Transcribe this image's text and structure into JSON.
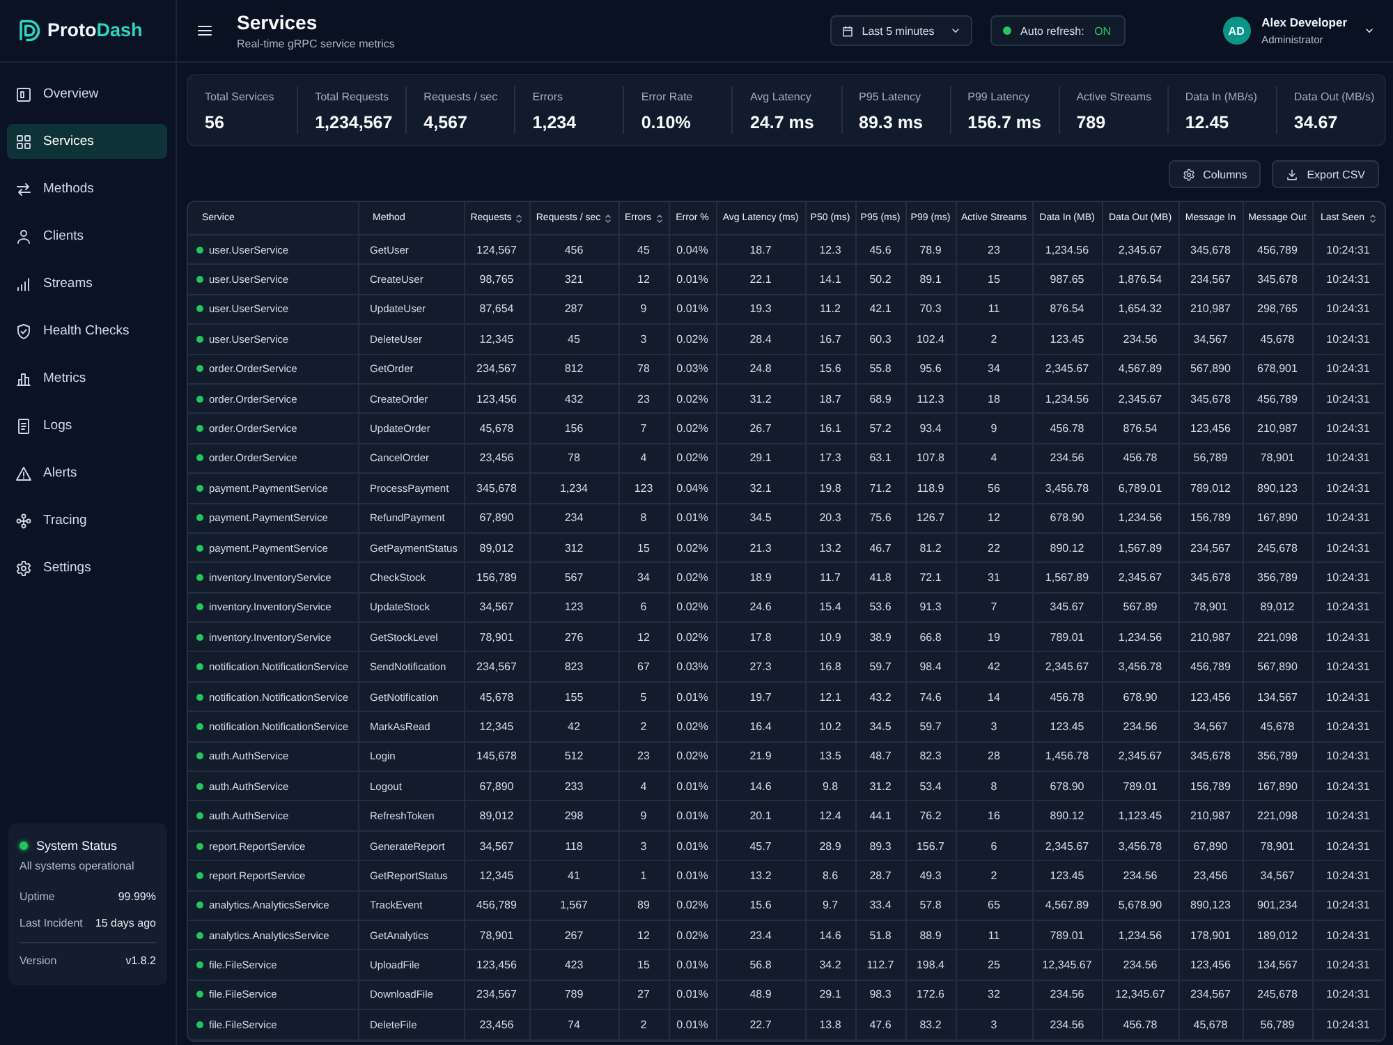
{
  "sidebar": {
    "brand": {
      "start": "Proto",
      "end": "Dash"
    },
    "items": [
      {
        "label": "Overview",
        "selected": false
      },
      {
        "label": "Services",
        "selected": true
      },
      {
        "label": "Methods",
        "selected": false
      },
      {
        "label": "Clients",
        "selected": false
      },
      {
        "label": "Streams",
        "selected": false
      },
      {
        "label": "Health Checks",
        "selected": false
      },
      {
        "label": "Metrics",
        "selected": false
      },
      {
        "label": "Logs",
        "selected": false
      },
      {
        "label": "Alerts",
        "selected": false
      },
      {
        "label": "Tracing",
        "selected": false
      },
      {
        "label": "Settings",
        "selected": false
      }
    ],
    "status": {
      "title": "System Status",
      "ok": true,
      "message": "All systems operational",
      "rows": [
        {
          "label": "Uptime",
          "value": "99.99%"
        },
        {
          "label": "Last Incident",
          "value": "15 days ago"
        }
      ],
      "version": {
        "label": "Version",
        "value": "v1.8.2"
      }
    }
  },
  "header": {
    "title": "Services",
    "subtitle": "Real-time gRPC service metrics",
    "time_range": {
      "value": "Last 5 minutes"
    },
    "auto_refresh": {
      "label": "Auto refresh:",
      "value": "ON",
      "on": true
    },
    "user": {
      "initials": "AD",
      "name": "Alex Developer",
      "role": "Administrator"
    }
  },
  "stats": [
    {
      "label": "Total Services",
      "value": "56"
    },
    {
      "label": "Total Requests",
      "value": "1,234,567"
    },
    {
      "label": "Requests / sec",
      "value": "4,567"
    },
    {
      "label": "Errors",
      "value": "1,234"
    },
    {
      "label": "Error Rate",
      "value": "0.10%"
    },
    {
      "label": "Avg Latency",
      "value": "24.7 ms"
    },
    {
      "label": "P95 Latency",
      "value": "89.3 ms"
    },
    {
      "label": "P99 Latency",
      "value": "156.7 ms"
    },
    {
      "label": "Active Streams",
      "value": "789"
    },
    {
      "label": "Data In (MB/s)",
      "value": "12.45"
    },
    {
      "label": "Data Out (MB/s)",
      "value": "34.67"
    }
  ],
  "toolbar": {
    "buttons": [
      "Columns",
      "Export CSV"
    ]
  },
  "table": {
    "columns": [
      {
        "label": "Service",
        "sortable": false
      },
      {
        "label": "Method",
        "sortable": false
      },
      {
        "label": "Requests",
        "sortable": true
      },
      {
        "label": "Requests / sec",
        "sortable": true
      },
      {
        "label": "Errors",
        "sortable": true
      },
      {
        "label": "Error %",
        "sortable": false
      },
      {
        "label": "Avg Latency (ms)",
        "sortable": false
      },
      {
        "label": "P50 (ms)",
        "sortable": false
      },
      {
        "label": "P95 (ms)",
        "sortable": false
      },
      {
        "label": "P99 (ms)",
        "sortable": false
      },
      {
        "label": "Active Streams",
        "sortable": false
      },
      {
        "label": "Data In (MB)",
        "sortable": false
      },
      {
        "label": "Data Out (MB)",
        "sortable": false
      },
      {
        "label": "Message In",
        "sortable": false
      },
      {
        "label": "Message Out",
        "sortable": false
      },
      {
        "label": "Last Seen",
        "sortable": true
      }
    ],
    "rows": [
      {
        "color": "#22c55e",
        "cells": [
          "user.UserService",
          "GetUser",
          "124,567",
          "456",
          "45",
          "0.04%",
          "18.7",
          "12.3",
          "45.6",
          "78.9",
          "23",
          "1,234.56",
          "2,345.67",
          "345,678",
          "456,789",
          "10:24:31"
        ]
      },
      {
        "color": "#22c55e",
        "cells": [
          "user.UserService",
          "CreateUser",
          "98,765",
          "321",
          "12",
          "0.01%",
          "22.1",
          "14.1",
          "50.2",
          "89.1",
          "15",
          "987.65",
          "1,876.54",
          "234,567",
          "345,678",
          "10:24:31"
        ]
      },
      {
        "color": "#22c55e",
        "cells": [
          "user.UserService",
          "UpdateUser",
          "87,654",
          "287",
          "9",
          "0.01%",
          "19.3",
          "11.2",
          "42.1",
          "70.3",
          "11",
          "876.54",
          "1,654.32",
          "210,987",
          "298,765",
          "10:24:31"
        ]
      },
      {
        "color": "#22c55e",
        "cells": [
          "user.UserService",
          "DeleteUser",
          "12,345",
          "45",
          "3",
          "0.02%",
          "28.4",
          "16.7",
          "60.3",
          "102.4",
          "2",
          "123.45",
          "234.56",
          "34,567",
          "45,678",
          "10:24:31"
        ]
      },
      {
        "color": "#22c55e",
        "cells": [
          "order.OrderService",
          "GetOrder",
          "234,567",
          "812",
          "78",
          "0.03%",
          "24.8",
          "15.6",
          "55.8",
          "95.6",
          "34",
          "2,345.67",
          "4,567.89",
          "567,890",
          "678,901",
          "10:24:31"
        ]
      },
      {
        "color": "#22c55e",
        "cells": [
          "order.OrderService",
          "CreateOrder",
          "123,456",
          "432",
          "23",
          "0.02%",
          "31.2",
          "18.7",
          "68.9",
          "112.3",
          "18",
          "1,234.56",
          "2,345.67",
          "345,678",
          "456,789",
          "10:24:31"
        ]
      },
      {
        "color": "#22c55e",
        "cells": [
          "order.OrderService",
          "UpdateOrder",
          "45,678",
          "156",
          "7",
          "0.02%",
          "26.7",
          "16.1",
          "57.2",
          "93.4",
          "9",
          "456.78",
          "876.54",
          "123,456",
          "210,987",
          "10:24:31"
        ]
      },
      {
        "color": "#22c55e",
        "cells": [
          "order.OrderService",
          "CancelOrder",
          "23,456",
          "78",
          "4",
          "0.02%",
          "29.1",
          "17.3",
          "63.1",
          "107.8",
          "4",
          "234.56",
          "456.78",
          "56,789",
          "78,901",
          "10:24:31"
        ]
      },
      {
        "color": "#22c55e",
        "cells": [
          "payment.PaymentService",
          "ProcessPayment",
          "345,678",
          "1,234",
          "123",
          "0.04%",
          "32.1",
          "19.8",
          "71.2",
          "118.9",
          "56",
          "3,456.78",
          "6,789.01",
          "789,012",
          "890,123",
          "10:24:31"
        ]
      },
      {
        "color": "#22c55e",
        "cells": [
          "payment.PaymentService",
          "RefundPayment",
          "67,890",
          "234",
          "8",
          "0.01%",
          "34.5",
          "20.3",
          "75.6",
          "126.7",
          "12",
          "678.90",
          "1,234.56",
          "156,789",
          "167,890",
          "10:24:31"
        ]
      },
      {
        "color": "#22c55e",
        "cells": [
          "payment.PaymentService",
          "GetPaymentStatus",
          "89,012",
          "312",
          "15",
          "0.02%",
          "21.3",
          "13.2",
          "46.7",
          "81.2",
          "22",
          "890.12",
          "1,567.89",
          "234,567",
          "245,678",
          "10:24:31"
        ]
      },
      {
        "color": "#22c55e",
        "cells": [
          "inventory.InventoryService",
          "CheckStock",
          "156,789",
          "567",
          "34",
          "0.02%",
          "18.9",
          "11.7",
          "41.8",
          "72.1",
          "31",
          "1,567.89",
          "2,345.67",
          "345,678",
          "356,789",
          "10:24:31"
        ]
      },
      {
        "color": "#22c55e",
        "cells": [
          "inventory.InventoryService",
          "UpdateStock",
          "34,567",
          "123",
          "6",
          "0.02%",
          "24.6",
          "15.4",
          "53.6",
          "91.3",
          "7",
          "345.67",
          "567.89",
          "78,901",
          "89,012",
          "10:24:31"
        ]
      },
      {
        "color": "#22c55e",
        "cells": [
          "inventory.InventoryService",
          "GetStockLevel",
          "78,901",
          "276",
          "12",
          "0.02%",
          "17.8",
          "10.9",
          "38.9",
          "66.8",
          "19",
          "789.01",
          "1,234.56",
          "210,987",
          "221,098",
          "10:24:31"
        ]
      },
      {
        "color": "#22c55e",
        "cells": [
          "notification.NotificationService",
          "SendNotification",
          "234,567",
          "823",
          "67",
          "0.03%",
          "27.3",
          "16.8",
          "59.7",
          "98.4",
          "42",
          "2,345.67",
          "3,456.78",
          "456,789",
          "567,890",
          "10:24:31"
        ]
      },
      {
        "color": "#22c55e",
        "cells": [
          "notification.NotificationService",
          "GetNotification",
          "45,678",
          "155",
          "5",
          "0.01%",
          "19.7",
          "12.1",
          "43.2",
          "74.6",
          "14",
          "456.78",
          "678.90",
          "123,456",
          "134,567",
          "10:24:31"
        ]
      },
      {
        "color": "#22c55e",
        "cells": [
          "notification.NotificationService",
          "MarkAsRead",
          "12,345",
          "42",
          "2",
          "0.02%",
          "16.4",
          "10.2",
          "34.5",
          "59.7",
          "3",
          "123.45",
          "234.56",
          "34,567",
          "45,678",
          "10:24:31"
        ]
      },
      {
        "color": "#22c55e",
        "cells": [
          "auth.AuthService",
          "Login",
          "145,678",
          "512",
          "23",
          "0.02%",
          "21.9",
          "13.5",
          "48.7",
          "82.3",
          "28",
          "1,456.78",
          "2,345.67",
          "345,678",
          "356,789",
          "10:24:31"
        ]
      },
      {
        "color": "#22c55e",
        "cells": [
          "auth.AuthService",
          "Logout",
          "67,890",
          "233",
          "4",
          "0.01%",
          "14.6",
          "9.8",
          "31.2",
          "53.4",
          "8",
          "678.90",
          "789.01",
          "156,789",
          "167,890",
          "10:24:31"
        ]
      },
      {
        "color": "#22c55e",
        "cells": [
          "auth.AuthService",
          "RefreshToken",
          "89,012",
          "298",
          "9",
          "0.01%",
          "20.1",
          "12.4",
          "44.1",
          "76.2",
          "16",
          "890.12",
          "1,123.45",
          "210,987",
          "221,098",
          "10:24:31"
        ]
      },
      {
        "color": "#22c55e",
        "cells": [
          "report.ReportService",
          "GenerateReport",
          "34,567",
          "118",
          "3",
          "0.01%",
          "45.7",
          "28.9",
          "89.3",
          "156.7",
          "6",
          "2,345.67",
          "3,456.78",
          "67,890",
          "78,901",
          "10:24:31"
        ]
      },
      {
        "color": "#22c55e",
        "cells": [
          "report.ReportService",
          "GetReportStatus",
          "12,345",
          "41",
          "1",
          "0.01%",
          "13.2",
          "8.6",
          "28.7",
          "49.3",
          "2",
          "123.45",
          "234.56",
          "23,456",
          "34,567",
          "10:24:31"
        ]
      },
      {
        "color": "#22c55e",
        "cells": [
          "analytics.AnalyticsService",
          "TrackEvent",
          "456,789",
          "1,567",
          "89",
          "0.02%",
          "15.6",
          "9.7",
          "33.4",
          "57.8",
          "65",
          "4,567.89",
          "5,678.90",
          "890,123",
          "901,234",
          "10:24:31"
        ]
      },
      {
        "color": "#22c55e",
        "cells": [
          "analytics.AnalyticsService",
          "GetAnalytics",
          "78,901",
          "267",
          "12",
          "0.02%",
          "23.4",
          "14.6",
          "51.8",
          "88.9",
          "11",
          "789.01",
          "1,234.56",
          "178,901",
          "189,012",
          "10:24:31"
        ]
      },
      {
        "color": "#22c55e",
        "cells": [
          "file.FileService",
          "UploadFile",
          "123,456",
          "423",
          "15",
          "0.01%",
          "56.8",
          "34.2",
          "112.7",
          "198.4",
          "25",
          "12,345.67",
          "234.56",
          "123,456",
          "134,567",
          "10:24:31"
        ]
      },
      {
        "color": "#22c55e",
        "cells": [
          "file.FileService",
          "DownloadFile",
          "234,567",
          "789",
          "27",
          "0.01%",
          "48.9",
          "29.1",
          "98.3",
          "172.6",
          "32",
          "234.56",
          "12,345.67",
          "234,567",
          "245,678",
          "10:24:31"
        ]
      },
      {
        "color": "#22c55e",
        "cells": [
          "file.FileService",
          "DeleteFile",
          "23,456",
          "74",
          "2",
          "0.01%",
          "22.7",
          "13.8",
          "47.6",
          "83.2",
          "3",
          "234.56",
          "456.78",
          "45,678",
          "56,789",
          "10:24:31"
        ]
      }
    ]
  }
}
